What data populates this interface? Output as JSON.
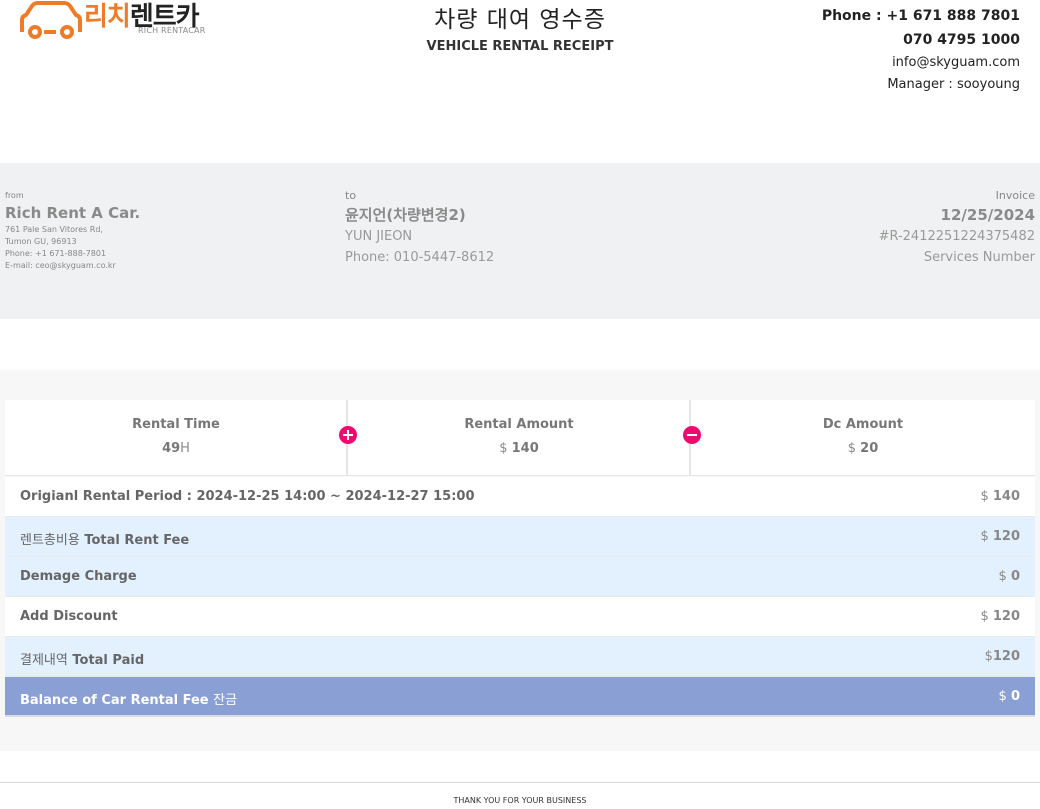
{
  "header": {
    "logo": {
      "korean_text": "리치렌트카",
      "korean_orange": "리치",
      "korean_dark": "렌트카",
      "english_text": "RICH RENTACAR"
    },
    "title_korean": "차량 대여 영수증",
    "title_english": "VEHICLE RENTAL RECEIPT",
    "contact": {
      "phone_line": "Phone : +1 671 888 7801",
      "phone_line2": "070 4795 1000",
      "email": "info@skyguam.com",
      "manager": "Manager : sooyoung"
    }
  },
  "from": {
    "label": "from",
    "company": "Rich Rent A Car.",
    "address1": "761 Pale San Vitores Rd,",
    "address2": "Tumon GU, 96913",
    "phone": "Phone: +1 671-888-7801",
    "email": "E-mail: ceo@skyguam.co.kr"
  },
  "to": {
    "label": "to",
    "name_korean": "윤지언(차량변경2)",
    "name_english": "YUN JIEON",
    "phone": "Phone: 010-5447-8612"
  },
  "invoice": {
    "label": "Invoice",
    "date": "12/25/2024",
    "number": "#R-2412251224375482",
    "services_label": "Services Number"
  },
  "stats": {
    "rental_time": {
      "label": "Rental Time",
      "value": "49",
      "unit": "H"
    },
    "rental_amount": {
      "label": "Rental Amount",
      "currency": "$",
      "value": "140"
    },
    "dc_amount": {
      "label": "Dc Amount",
      "currency": "$",
      "value": "20"
    }
  },
  "rows": [
    {
      "label": "Origianl Rental Period : 2024-12-25 14:00 ~ 2024-12-27 15:00",
      "korean": "",
      "currency": "$",
      "amount": "140"
    },
    {
      "label": "Total Rent Fee",
      "korean": "렌트총비용",
      "currency": "$",
      "amount": "120"
    },
    {
      "label": "Demage Charge",
      "korean": "",
      "currency": "$",
      "amount": "0"
    },
    {
      "label": "Add Discount",
      "korean": "",
      "currency": "$",
      "amount": "120"
    },
    {
      "label": "Total Paid",
      "korean": "결제내역",
      "currency": "$",
      "amount": "120"
    },
    {
      "label": "Balance of Car Rental Fee",
      "korean": "잔금",
      "currency": "$",
      "amount": "0"
    }
  ],
  "footer": {
    "text": "THANK YOU FOR YOUR BUSINESS"
  },
  "colors": {
    "logo_orange": "#ef7b26",
    "accent_pink": "#ee0a6e",
    "row_blue": "#e3f0fe",
    "balance_row": "#8aa0d4",
    "info_band": "#eff1f2"
  }
}
